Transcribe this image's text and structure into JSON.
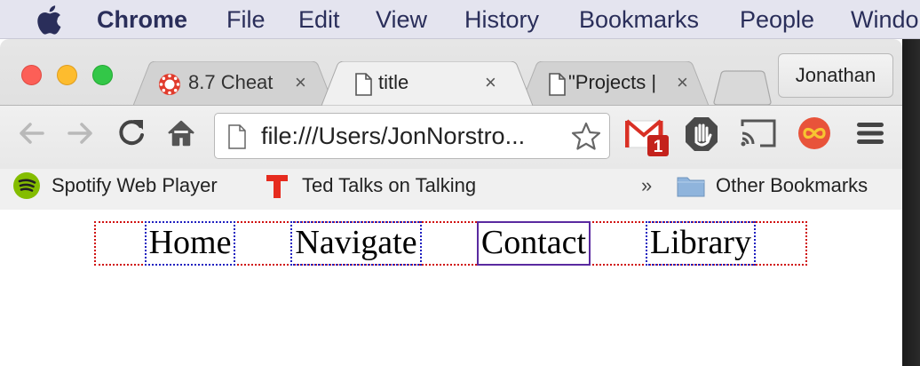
{
  "menubar": {
    "items": [
      "Chrome",
      "File",
      "Edit",
      "View",
      "History",
      "Bookmarks",
      "People",
      "Windo"
    ]
  },
  "tabs": [
    {
      "title": "8.7 Cheat",
      "icon": "canvas-lms-icon",
      "close": "×"
    },
    {
      "title": "title",
      "icon": "document-icon",
      "close": "×",
      "active": true
    },
    {
      "title": "\"Projects |",
      "icon": "document-icon",
      "close": "×"
    }
  ],
  "profile": {
    "name": "Jonathan"
  },
  "omnibox": {
    "url": "file:///Users/JonNorstro..."
  },
  "extensions": {
    "gmail_badge": "1",
    "icons": [
      "gmail-icon",
      "adblock-icon",
      "cast-icon",
      "infinity-extension-icon",
      "menu-icon"
    ]
  },
  "bookmarks": {
    "items": [
      {
        "label": "Spotify Web Player",
        "icon": "spotify-icon"
      },
      {
        "label": "Ted Talks on Talking",
        "icon": "ted-icon"
      }
    ],
    "overflow": "»",
    "other": "Other Bookmarks"
  },
  "nav": {
    "links": [
      "Home",
      "Navigate",
      "Contact",
      "Library"
    ],
    "active_index": 2
  },
  "colors": {
    "menubar_bg": "#e4e4ef",
    "nav_border": "#d01010",
    "link_border": "#2020c0",
    "active_link_border": "#5a2aa0"
  }
}
